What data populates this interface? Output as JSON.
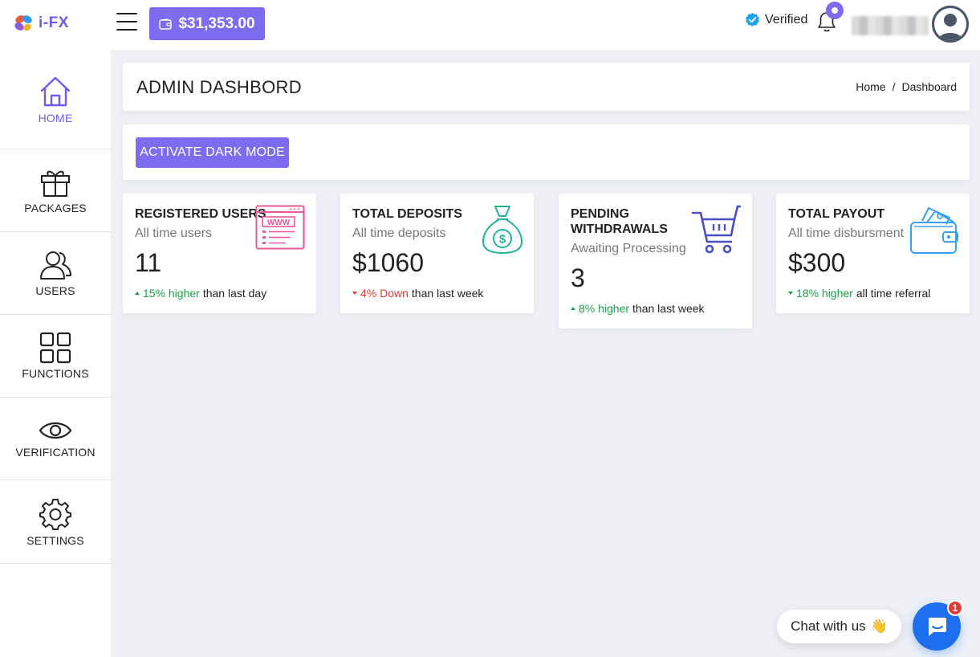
{
  "brand": {
    "name": "i-FX"
  },
  "header": {
    "balance": "$31,353.00",
    "verified_label": "Verified"
  },
  "sidebar": {
    "items": [
      {
        "label": "HOME",
        "icon": "home-icon",
        "active": true
      },
      {
        "label": "PACKAGES",
        "icon": "gift-icon"
      },
      {
        "label": "USERS",
        "icon": "users-icon"
      },
      {
        "label": "FUNCTIONS",
        "icon": "grid-icon"
      },
      {
        "label": "VERIFICATION",
        "icon": "eye-icon"
      },
      {
        "label": "SETTINGS",
        "icon": "gear-icon"
      }
    ]
  },
  "page": {
    "title": "ADMIN DASHBORD",
    "breadcrumb": {
      "home": "Home",
      "sep": "/",
      "current": "Dashboard"
    },
    "dark_mode_button": "ACTIVATE DARK MODE"
  },
  "stats": [
    {
      "title": "REGISTERED USERS",
      "subtitle": "All time users",
      "value": "11",
      "trend_value": "15% higher",
      "trend_text": "than last day",
      "direction": "up",
      "icon": "web-browser-icon",
      "icon_color": "#f0569a"
    },
    {
      "title": "TOTAL DEPOSITS",
      "subtitle": "All time deposits",
      "value": "$1060",
      "trend_value": "4% Down",
      "trend_text": "than last week",
      "direction": "down",
      "icon": "money-bag-icon",
      "icon_color": "#1fb39a"
    },
    {
      "title": "PENDING WITHDRAWALS",
      "subtitle": "Awaiting Processing",
      "value": "3",
      "trend_value": "8% higher",
      "trend_text": "than last week",
      "direction": "up",
      "icon": "shopping-cart-icon",
      "icon_color": "#4a4fc2"
    },
    {
      "title": "TOTAL PAYOUT",
      "subtitle": "All time disbursment",
      "value": "$300",
      "trend_value": "18% higher",
      "trend_text": "all time referral",
      "direction": "down-green",
      "icon": "wallet-icon",
      "icon_color": "#3aa0f0"
    }
  ],
  "chat": {
    "label": "Chat with us",
    "emoji": "👋",
    "badge": "1"
  },
  "colors": {
    "accent": "#7d6cf0",
    "up": "#1aa34a",
    "down": "#e53935",
    "chat": "#1e6ff0"
  }
}
